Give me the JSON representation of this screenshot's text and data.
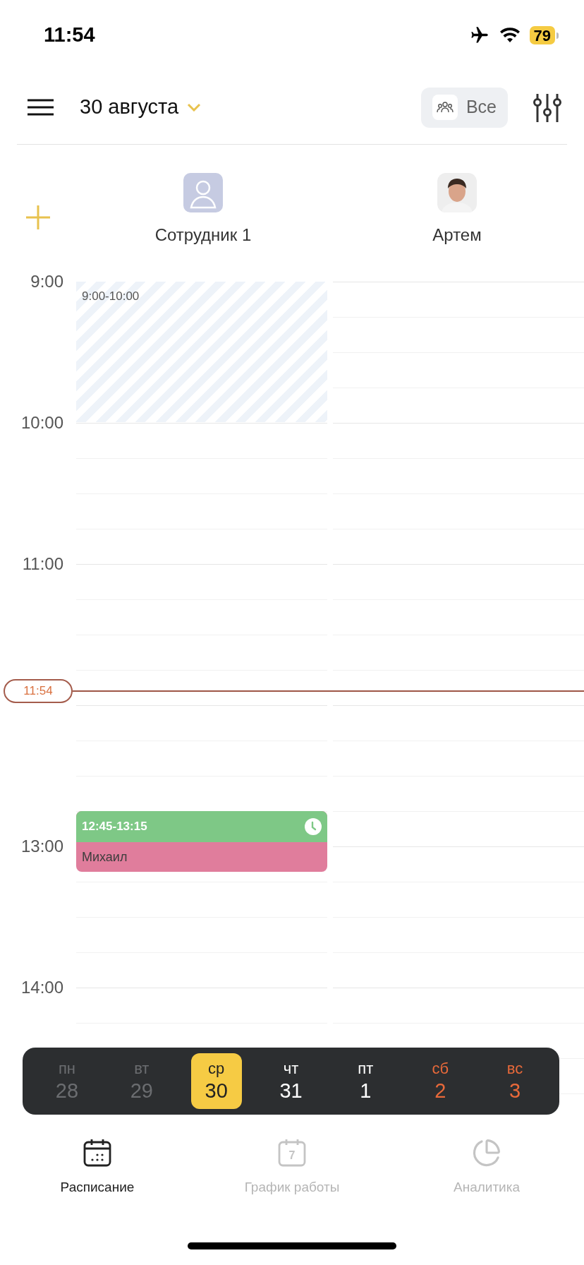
{
  "status_bar": {
    "time": "11:54",
    "battery": "79"
  },
  "header": {
    "title": "30 августа",
    "filter": {
      "label": "Все"
    }
  },
  "employees": [
    {
      "name": "Сотрудник 1",
      "kind": "placeholder"
    },
    {
      "name": "Артем"
    }
  ],
  "hours": [
    {
      "kind": "label",
      "label": "9:00"
    },
    {
      "kind": "label",
      "label": "10:00"
    },
    {
      "kind": "label",
      "label": "11:00"
    },
    {
      "kind": "covered"
    },
    {
      "kind": "label",
      "label": "13:00"
    },
    {
      "kind": "label",
      "label": "14:00"
    }
  ],
  "now": {
    "label": "11:54"
  },
  "events": [
    {
      "kind": "blocked",
      "time": "9:00-10:00"
    },
    {
      "kind": "appointment",
      "time": "12:45-13:15",
      "client": "Михаил"
    }
  ],
  "days": [
    {
      "weekday": "пн",
      "date": "28",
      "kind": "past",
      "selected": false
    },
    {
      "weekday": "вт",
      "date": "29",
      "kind": "past",
      "selected": false
    },
    {
      "weekday": "ср",
      "date": "30",
      "kind": "weekday",
      "selected": true
    },
    {
      "weekday": "чт",
      "date": "31",
      "kind": "weekday",
      "selected": false
    },
    {
      "weekday": "пт",
      "date": "1",
      "kind": "weekday",
      "selected": false
    },
    {
      "weekday": "сб",
      "date": "2",
      "kind": "weekend",
      "selected": false
    },
    {
      "weekday": "вс",
      "date": "3",
      "kind": "weekend",
      "selected": false
    }
  ],
  "tabs": [
    {
      "label": "Расписание",
      "kind": "schedule",
      "selected": true
    },
    {
      "label": "График работы",
      "kind": "workdays",
      "icon_text": "7",
      "selected": false
    },
    {
      "label": "Аналитика",
      "kind": "analytics",
      "selected": false
    }
  ]
}
